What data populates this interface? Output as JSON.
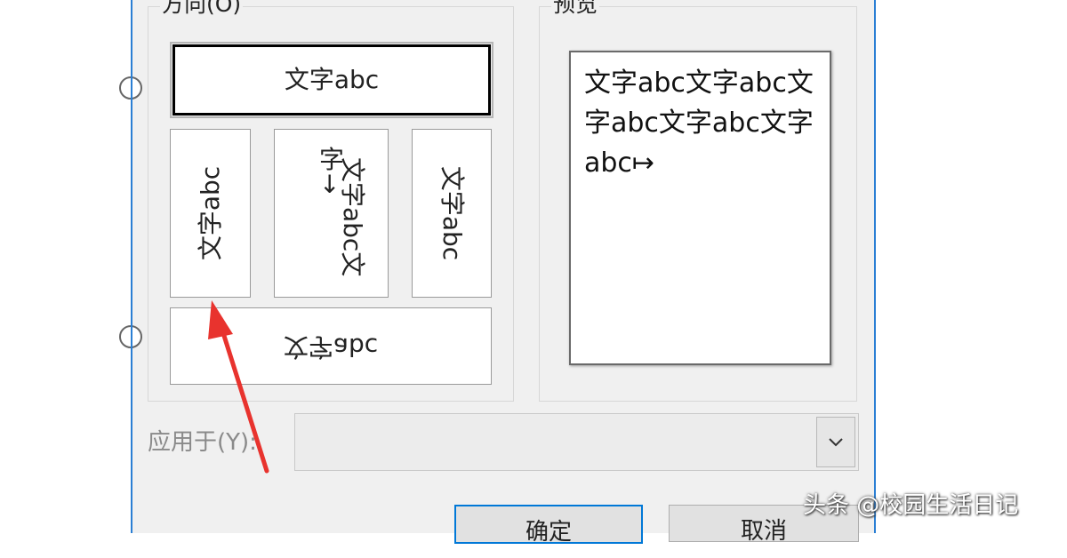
{
  "direction_group": {
    "title": "方向(O)",
    "options": {
      "horizontal": "文字abc",
      "vertical_rotated_down": "文字abc",
      "vertical_stacked": {
        "col1": "字↓",
        "col2": "文字abc文"
      },
      "vertical_rotated_up": "文字abc",
      "horizontal_mirrored": "文字abc"
    }
  },
  "preview_group": {
    "title": "预览",
    "text": "文字abc文字abc文字abc文字abc文字abc↦"
  },
  "apply_to": {
    "label": "应用于(Y):",
    "value": ""
  },
  "buttons": {
    "ok": "确定",
    "cancel": "取消"
  },
  "watermark": "头条 @校园生活日记",
  "colors": {
    "arrow": "#e8332e",
    "accent": "#0078d7"
  }
}
